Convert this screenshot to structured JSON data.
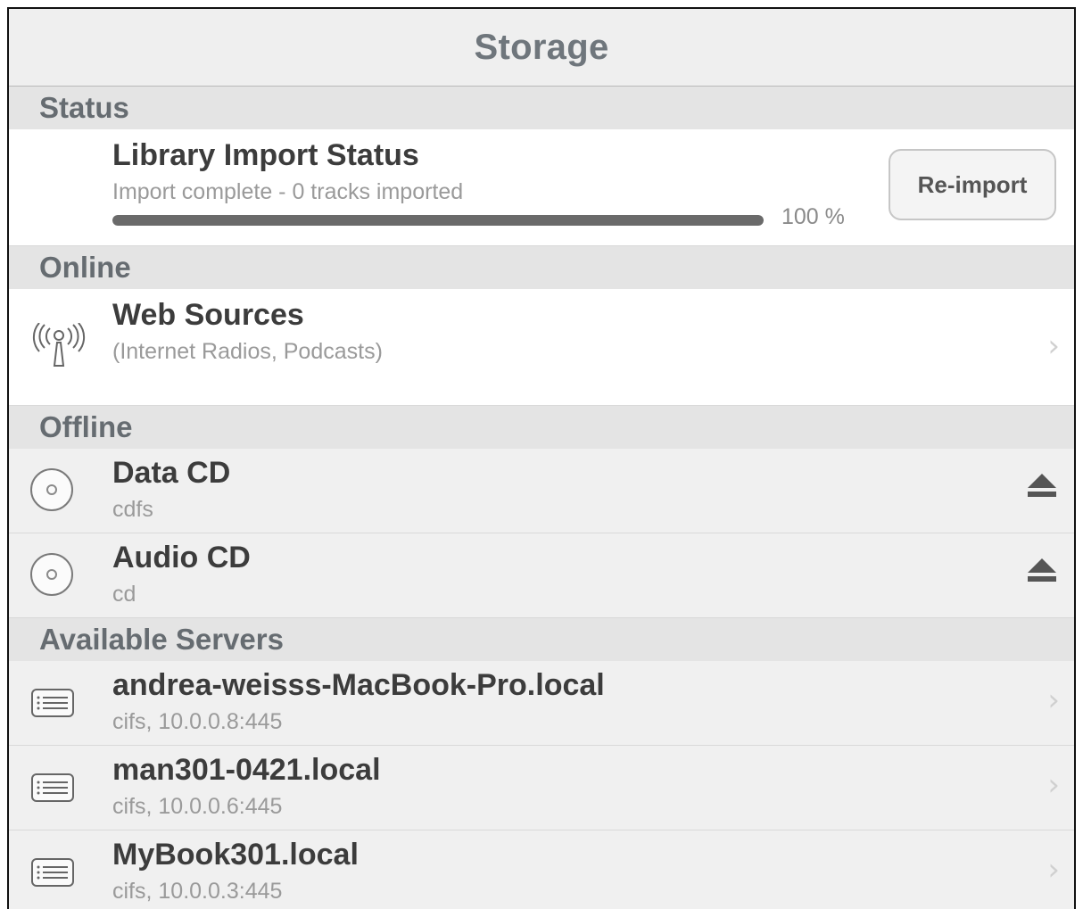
{
  "header": {
    "title": "Storage"
  },
  "sections": {
    "status": "Status",
    "online": "Online",
    "offline": "Offline",
    "servers": "Available Servers"
  },
  "status_row": {
    "title": "Library Import Status",
    "subtitle": "Import complete - 0 tracks imported",
    "progress_percent": 100,
    "progress_label": "100 %",
    "button_label": "Re-import"
  },
  "web_sources": {
    "title": "Web Sources",
    "subtitle": "(Internet Radios, Podcasts)",
    "icon": "antenna-icon"
  },
  "offline_items": [
    {
      "title": "Data CD",
      "subtitle": "cdfs",
      "icon": "cd-icon",
      "action_icon": "eject-icon"
    },
    {
      "title": "Audio CD",
      "subtitle": "cd",
      "icon": "cd-icon",
      "action_icon": "eject-icon"
    }
  ],
  "servers": [
    {
      "title": "andrea-weisss-MacBook-Pro.local",
      "subtitle": "cifs, 10.0.0.8:445",
      "icon": "server-icon"
    },
    {
      "title": "man301-0421.local",
      "subtitle": "cifs, 10.0.0.6:445",
      "icon": "server-icon"
    },
    {
      "title": "MyBook301.local",
      "subtitle": "cifs, 10.0.0.3:445",
      "icon": "server-icon"
    }
  ],
  "chevron_glyph": "›",
  "colors": {
    "progress_fill": "#6a6a6a",
    "section_bg": "#e4e4e4",
    "header_text": "#6f767c"
  }
}
